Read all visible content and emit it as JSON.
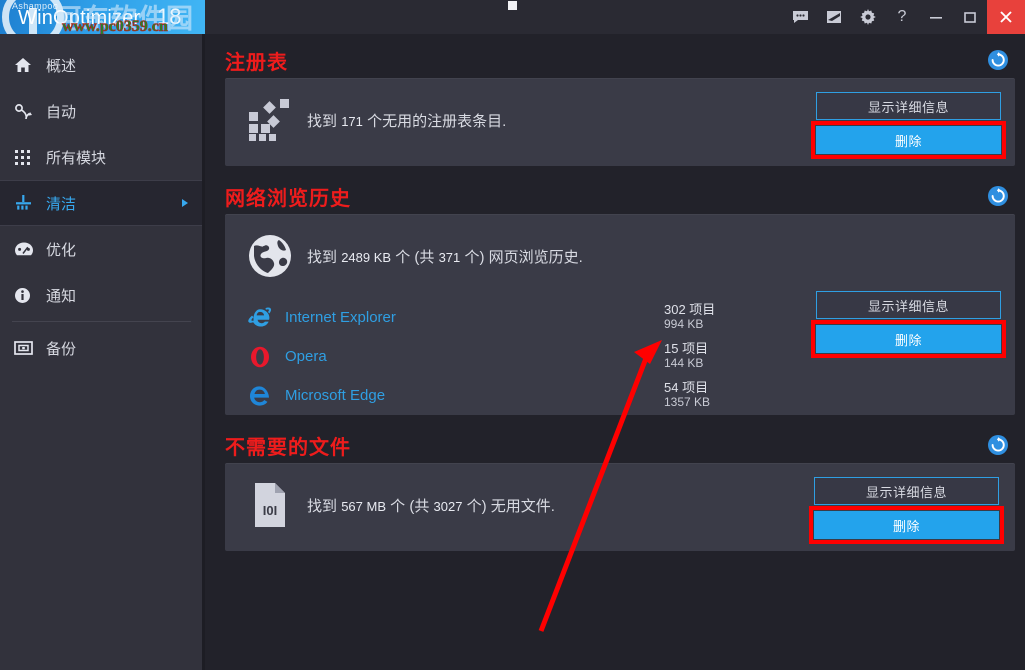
{
  "window": {
    "app_title": "Ashampoo WinOptimizer 18",
    "brand": "Ashampoo",
    "product": "WinOptimizer",
    "version": "18",
    "watermark_cn": "河东软件园",
    "watermark_url": "www.pc0359.cn",
    "titlebar_icons": [
      {
        "name": "chat-icon",
        "glyph": "chat"
      },
      {
        "name": "banner-icon",
        "glyph": "banner"
      },
      {
        "name": "gear-icon",
        "glyph": "gear"
      },
      {
        "name": "help-icon",
        "glyph": "?"
      }
    ],
    "controls": {
      "minimize": "—",
      "maximize": "▢",
      "close": "✕"
    }
  },
  "sidebar": {
    "items": [
      {
        "label": "概述",
        "icon": "home-icon",
        "active": false,
        "has_chevron": false
      },
      {
        "label": "自动",
        "icon": "auto-icon",
        "active": false,
        "has_chevron": false
      },
      {
        "label": "所有模块",
        "icon": "modules-icon",
        "active": false,
        "has_chevron": false
      },
      {
        "label": "清洁",
        "icon": "broom-icon",
        "active": true,
        "has_chevron": true
      },
      {
        "label": "优化",
        "icon": "gauge-icon",
        "active": false,
        "has_chevron": false
      },
      {
        "label": "通知",
        "icon": "info-icon",
        "active": false,
        "has_chevron": false
      },
      {
        "label": "备份",
        "icon": "backup-icon",
        "active": false,
        "has_chevron": false
      }
    ]
  },
  "buttons": {
    "details_label": "显示详细信息",
    "delete_label": "删除"
  },
  "sections": [
    {
      "id": "registry",
      "title": "注册表",
      "icon": "registry-icon",
      "summary_prefix": "找到",
      "summary_count": "171",
      "summary_suffix": "个无用的注册表条目.",
      "refresh_icon": "refresh-icon"
    },
    {
      "id": "web-history",
      "title": "网络浏览历史",
      "icon": "globe-icon",
      "summary_prefix": "找到",
      "summary_count": "2489 KB",
      "summary_mid": "个 (共",
      "summary_count2": "371",
      "summary_suffix": "个) 网页浏览历史.",
      "refresh_icon": "refresh-icon",
      "browsers": [
        {
          "name": "Internet Explorer",
          "icon": "internet-explorer-icon",
          "items": "302 项目",
          "size": "994 KB"
        },
        {
          "name": "Opera",
          "icon": "opera-icon",
          "items": "15 项目",
          "size": "144 KB"
        },
        {
          "name": "Microsoft Edge",
          "icon": "microsoft-edge-icon",
          "items": "54 项目",
          "size": "1357 KB"
        }
      ]
    },
    {
      "id": "unneeded-files",
      "title": "不需要的文件",
      "icon": "file-icon",
      "summary_prefix": "找到",
      "summary_count": "567 MB",
      "summary_mid": "个 (共",
      "summary_count2": "3027",
      "summary_suffix": "个) 无用文件.",
      "refresh_icon": "refresh-icon"
    }
  ],
  "colors": {
    "accent": "#23a3ec",
    "annotation": "#ff0000",
    "panel": "#3a3b47",
    "background": "#22222a",
    "sidebar": "#32323c",
    "title_text": "#ee1c1c",
    "close": "#e8413c"
  }
}
